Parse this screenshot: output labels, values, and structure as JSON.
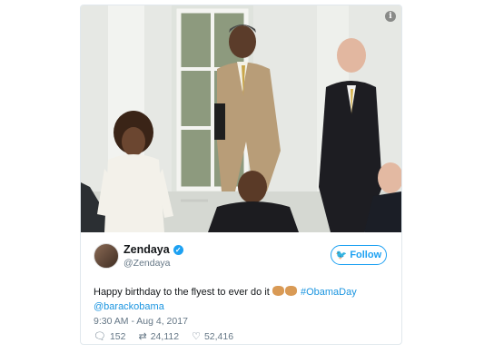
{
  "tweet": {
    "display_name": "Zendaya",
    "handle": "@Zendaya",
    "follow_label": "Follow",
    "text_main": "Happy birthday to the flyest to ever do it",
    "hashtag": "#ObamaDay",
    "mention": "@barackobama",
    "timestamp": "9:30 AM - Aug 4, 2017",
    "replies": "152",
    "retweets": "24,112",
    "likes": "52,416"
  },
  "colors": {
    "accent": "#1da1f2",
    "link": "#1b95e0",
    "muted": "#657786"
  },
  "icons": [
    "info-icon",
    "verified-icon",
    "twitter-bird-icon",
    "reply-icon",
    "retweet-icon",
    "like-icon",
    "clap-emoji-icon"
  ]
}
